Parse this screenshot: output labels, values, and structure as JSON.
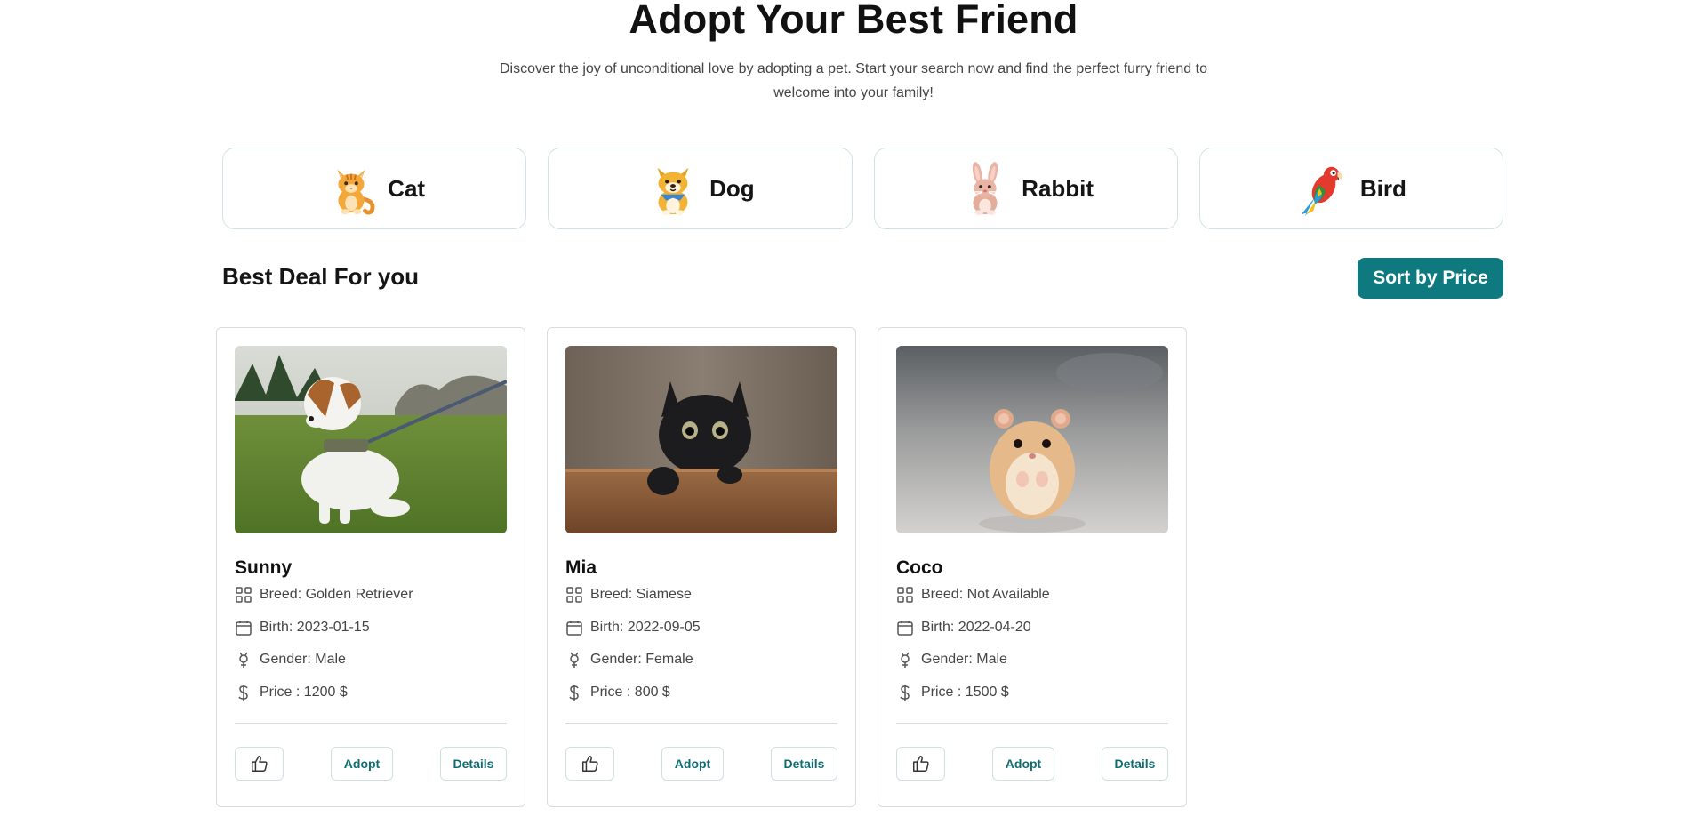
{
  "hero": {
    "title": "Adopt Your Best Friend",
    "subtitle": "Discover the joy of unconditional love by adopting a pet. Start your search now and find the perfect furry friend to welcome into your family!"
  },
  "categories": [
    {
      "label": "Cat",
      "icon": "cat-icon"
    },
    {
      "label": "Dog",
      "icon": "dog-icon"
    },
    {
      "label": "Rabbit",
      "icon": "rabbit-icon"
    },
    {
      "label": "Bird",
      "icon": "parrot-icon"
    }
  ],
  "section": {
    "title": "Best Deal For you",
    "sort_label": "Sort by Price"
  },
  "pets": [
    {
      "name": "Sunny",
      "image": "dog-photo",
      "breed": "Breed: Golden Retriever",
      "birth": "Birth: 2023-01-15",
      "gender": "Gender: Male",
      "price": "Price : 1200 $"
    },
    {
      "name": "Mia",
      "image": "black-cat-photo",
      "breed": "Breed: Siamese",
      "birth": "Birth: 2022-09-05",
      "gender": "Gender: Female",
      "price": "Price : 800 $"
    },
    {
      "name": "Coco",
      "image": "hamster-photo",
      "breed": "Breed: Not Available",
      "birth": "Birth: 2022-04-20",
      "gender": "Gender: Male",
      "price": "Price : 1500 $"
    }
  ],
  "card_actions": {
    "adopt_label": "Adopt",
    "details_label": "Details"
  },
  "colors": {
    "accent": "#0e7a80",
    "card_border": "#dcdcdc"
  }
}
